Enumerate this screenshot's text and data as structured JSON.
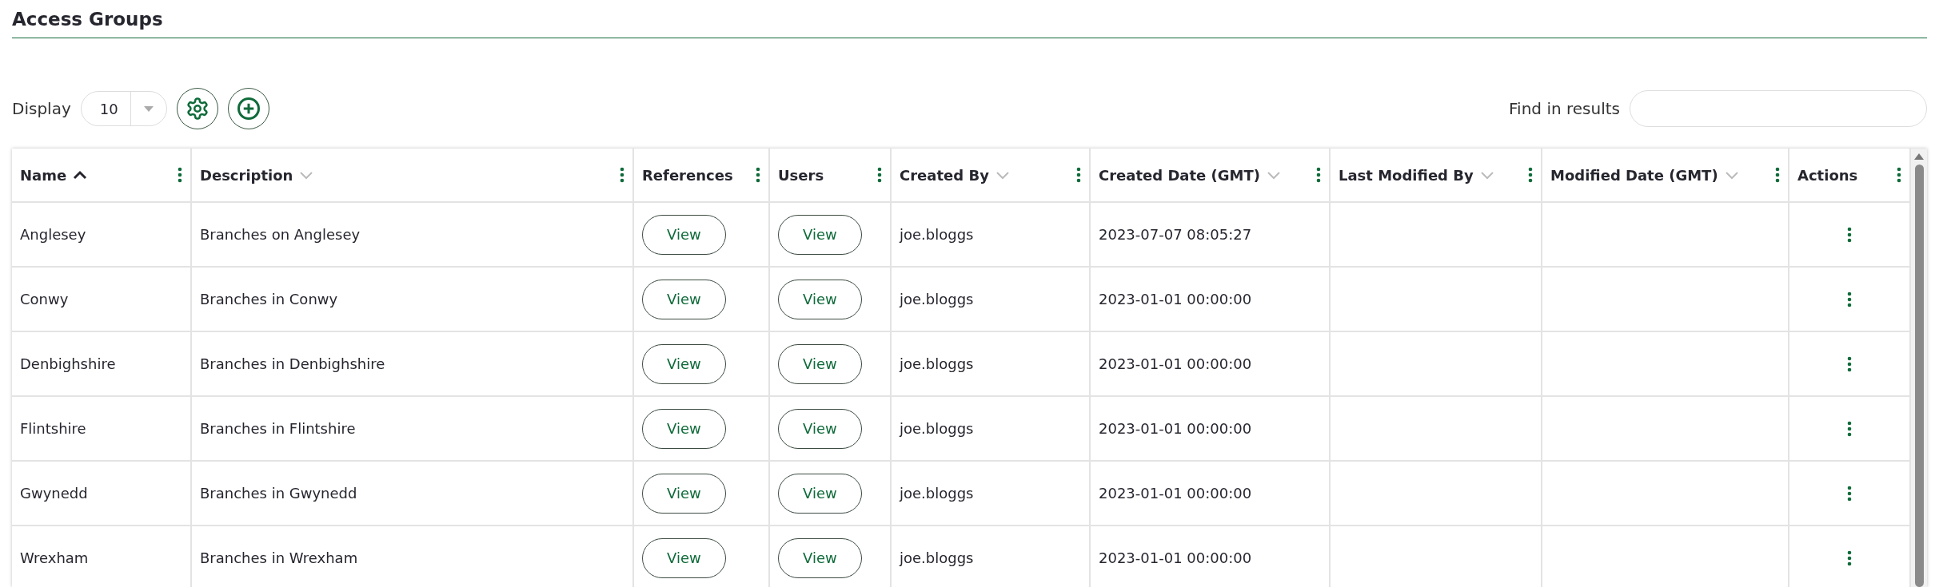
{
  "page": {
    "title": "Access Groups"
  },
  "toolbar": {
    "display_label": "Display",
    "page_size": "10",
    "search_label": "Find in results"
  },
  "table": {
    "columns": [
      {
        "label": "Name",
        "sortable": true,
        "sorted": true
      },
      {
        "label": "Description",
        "sortable": true,
        "sorted": false
      },
      {
        "label": "References",
        "sortable": false,
        "sorted": false
      },
      {
        "label": "Users",
        "sortable": false,
        "sorted": false
      },
      {
        "label": "Created By",
        "sortable": true,
        "sorted": false
      },
      {
        "label": "Created Date (GMT)",
        "sortable": true,
        "sorted": false
      },
      {
        "label": "Last Modified By",
        "sortable": true,
        "sorted": false
      },
      {
        "label": "Modified Date (GMT)",
        "sortable": true,
        "sorted": false
      },
      {
        "label": "Actions",
        "sortable": false,
        "sorted": false
      }
    ],
    "rows": [
      {
        "name": "Anglesey",
        "description": "Branches on Anglesey",
        "references": "View",
        "users": "View",
        "created_by": "joe.bloggs",
        "created_date": "2023-07-07 08:05:27"
      },
      {
        "name": "Conwy",
        "description": "Branches in Conwy",
        "references": "View",
        "users": "View",
        "created_by": "joe.bloggs",
        "created_date": "2023-01-01 00:00:00"
      },
      {
        "name": "Denbighshire",
        "description": "Branches in Denbighshire",
        "references": "View",
        "users": "View",
        "created_by": "joe.bloggs",
        "created_date": "2023-01-01 00:00:00"
      },
      {
        "name": "Flintshire",
        "description": "Branches in Flintshire",
        "references": "View",
        "users": "View",
        "created_by": "joe.bloggs",
        "created_date": "2023-01-01 00:00:00"
      },
      {
        "name": "Gwynedd",
        "description": "Branches in Gwynedd",
        "references": "View",
        "users": "View",
        "created_by": "joe.bloggs",
        "created_date": "2023-01-01 00:00:00"
      },
      {
        "name": "Wrexham",
        "description": "Branches in Wrexham",
        "references": "View",
        "users": "View",
        "created_by": "joe.bloggs",
        "created_date": "2023-01-01 00:00:00"
      }
    ]
  }
}
